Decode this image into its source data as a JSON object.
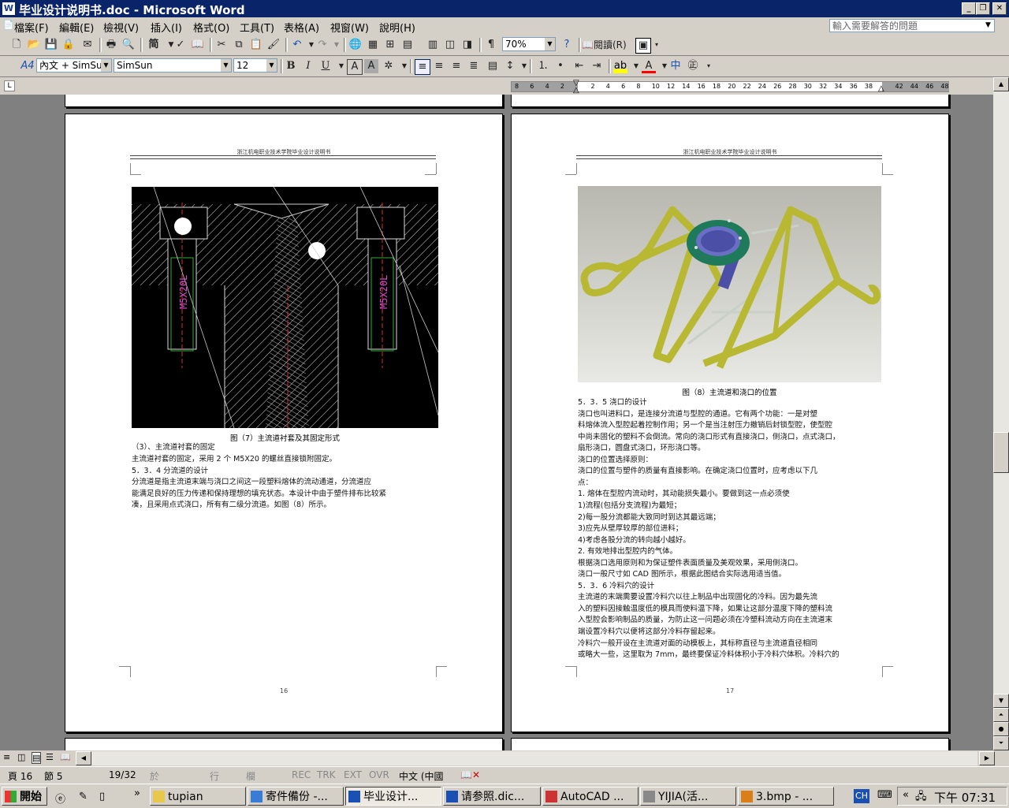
{
  "window": {
    "title": "毕业设计说明书.doc - Microsoft Word",
    "app_icon": "word-icon",
    "controls": [
      "minimize-icon",
      "restore-icon",
      "close-icon"
    ]
  },
  "menu": {
    "items": [
      "檔案(F)",
      "編輯(E)",
      "檢視(V)",
      "插入(I)",
      "格式(O)",
      "工具(T)",
      "表格(A)",
      "視窗(W)",
      "說明(H)"
    ],
    "ask_placeholder": "輸入需要解答的問題"
  },
  "standard_toolbar": {
    "zoom": "70%",
    "read_label": "閱讀(R)",
    "simplified_label": "简"
  },
  "format_toolbar": {
    "style": "內文 + SimSun",
    "font": "SimSun",
    "size": "12",
    "style_icon": "A4"
  },
  "ruler": {
    "ticks": [
      "8",
      "6",
      "4",
      "2",
      "",
      "2",
      "4",
      "6",
      "8",
      "10",
      "12",
      "14",
      "16",
      "18",
      "20",
      "22",
      "24",
      "26",
      "28",
      "30",
      "32",
      "34",
      "36",
      "38",
      "",
      "42",
      "44",
      "46",
      "48"
    ]
  },
  "page_left": {
    "header": "浙江机电职业技术学院毕业设计说明书",
    "figure": {
      "bolt_label_left": "M5X20L",
      "bolt_label_right": "M5X20L"
    },
    "caption": "图（7）主流道衬套及其固定形式",
    "lines": [
      "（3）、主流道衬套的固定",
      "      主流道衬套的固定，采用 2 个 M5X20 的螺丝直接锁附固定。",
      "5．3．4  分流道的设计",
      "      分流道是指主流道末端与浇口之间这一段塑料熔体的流动通道，分流道应",
      "能满足良好的压力传递和保持理想的填充状态。本设计中由于塑件排布比较紧",
      "凑，且采用点式浇口，所有有二级分流道。如图（8）所示。"
    ],
    "page_number": "16"
  },
  "page_right": {
    "header": "浙江机电职业技术学院毕业设计说明书",
    "caption": "图（8）主流道和浇口的位置",
    "lines": [
      "5．3．5  浇口的设计",
      "      浇口也叫进料口，是连接分流道与型腔的通道。它有两个功能：一是对塑",
      "料熔体流入型腔起着控制作用；另一个是当注射压力撤销后封锁型腔，使型腔",
      "中尚未固化的塑料不会倒流。常向的浇口形式有直接浇口，侧浇口，点式浇口，",
      "扇形浇口，圆盘式浇口，环形浇口等。",
      "浇口的位置选择原则：",
      "      浇口的位置与塑件的质量有直接影响。在确定浇口位置时，应考虑以下几",
      "点：",
      "  1. 熔体在型腔内流动时，其动能损失最小。要做到这一点必须使",
      "        1)流程(包括分支流程)为最短；",
      "        2)每一股分流都能大致同时到达其最远端；",
      "        3)应先从壁厚较厚的部位进料；",
      "        4)考虑各股分流的转向越小越好。",
      "2. 有效地排出型腔内的气体。",
      "根据浇口选用原则和为保证塑件表面质量及美观效果，采用侧浇口。",
      "      浇口一般尺寸如 CAD 图所示，根据此图结合实际选用适当值。",
      "5．3．6  冷料穴的设计",
      "      主流道的末端需要设置冷料穴以往上制品中出现固化的冷料。因为最先流",
      "入的塑料因接触温度低的模具而使料温下降，如果让这部分温度下降的塑料流",
      "入型腔会影响制品的质量，为防止这一问题必须在冷塑料流动方向在主流道末",
      "端设置冷料穴以便将这部分冷料存留起来。",
      "      冷料穴一般开设在主流道对面的动模板上，其标称直径与主流道直径相同",
      "或略大一些，这里取为 7mm，最终要保证冷料体积小于冷料穴体积。冷料穴的"
    ],
    "page_number": "17"
  },
  "status": {
    "page": "頁 16",
    "section": "節 5",
    "pages": "19/32",
    "at": "於",
    "line": "行",
    "col": "欄",
    "rec": "REC",
    "trk": "TRK",
    "ext": "EXT",
    "ovr": "OVR",
    "lang": "中文 (中國"
  },
  "taskbar": {
    "start": "開始",
    "tasks": [
      "tupian",
      "寄件備份 -...",
      "毕业设计...",
      "请参照.dic...",
      "AutoCAD ...",
      "YIJIA(活...",
      "3.bmp - ..."
    ],
    "active_index": 2,
    "ime": "CH",
    "clock": "下午 07:31"
  },
  "colors": {
    "title_bar": "#0a246a",
    "chrome": "#d4d0c8",
    "workspace": "#808080",
    "cad_background": "#000000",
    "render_part": "#b8b832",
    "render_ring": "#1e7a5a"
  }
}
